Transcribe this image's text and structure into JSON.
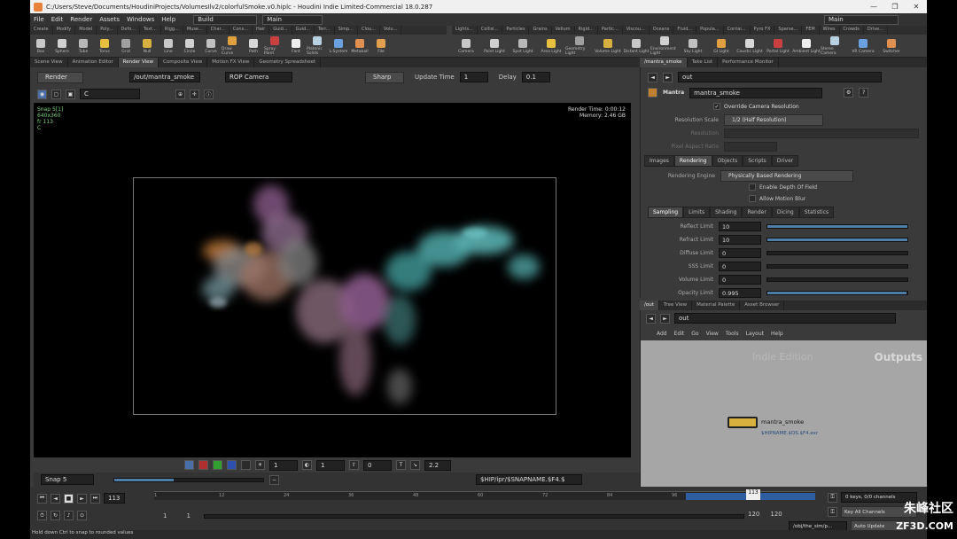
{
  "window": {
    "title": "C:/Users/Steve/Documents/HoudiniProjects/VolumesIlv2/colorfulSmoke.v0.hiplc - Houdini Indie Limited-Commercial 18.0.287",
    "minimize": "—",
    "maximize": "❐",
    "close": "✕"
  },
  "menubar": {
    "items": [
      "File",
      "Edit",
      "Render",
      "Assets",
      "Windows",
      "Help"
    ],
    "desktop": "Build",
    "scene": "Main",
    "right_scene": "Main"
  },
  "shelf": {
    "left_tabs": [
      "Create",
      "Modify",
      "Model",
      "Poly...",
      "Defo...",
      "Text...",
      "Rigg...",
      "Muse...",
      "Char...",
      "Cons...",
      "Hair",
      "Guid...",
      "Guid...",
      "Terr...",
      "Simp...",
      "Clou...",
      "Volu..."
    ],
    "left_tools": [
      "Box",
      "Sphere",
      "Tube",
      "Torus",
      "Grid",
      "Null",
      "Line",
      "Circle",
      "Curve",
      "Draw Curve",
      "Path",
      "Spray Paint",
      "Font",
      "Platonic Solids",
      "L-System",
      "Metaball",
      "File"
    ],
    "right_tabs": [
      "Lights...",
      "Collisi...",
      "Particles",
      "Grains",
      "Vellum",
      "Rigid...",
      "Partic...",
      "Viscou...",
      "Oceans",
      "Fluid...",
      "Popula...",
      "Contai...",
      "Pyro FX",
      "Sparse...",
      "FEM",
      "Wires",
      "Crowds",
      "Drive..."
    ],
    "right_tools": [
      "Camera",
      "Point Light",
      "Spot Light",
      "Area Light",
      "Geometry Light",
      "Volume Light",
      "Distant Light",
      "Environment Light",
      "Sky Light",
      "GI Light",
      "Caustic Light",
      "Portal Light",
      "Ambient Light",
      "Stereo Camera",
      "VR Camera",
      "Switcher"
    ]
  },
  "pane_tabs": {
    "left": [
      "Scene View",
      "Animation Editor",
      "Render View",
      "Composite View",
      "Motion FX View",
      "Geometry Spreadsheet"
    ],
    "params": [
      "/mantra_smoke",
      "Take List",
      "Performance Monitor"
    ],
    "network": [
      "/out",
      "Tree View",
      "Material Palette",
      "Asset Browser"
    ]
  },
  "render_toolbar": {
    "render_button": "Render",
    "rop_path": "/out/mantra_smoke",
    "camera": "ROP Camera",
    "sharp": "Sharp",
    "update_time_label": "Update Time",
    "update_time_value": "1",
    "delay_label": "Delay",
    "delay_value": "0.1",
    "channel": "C"
  },
  "viewport": {
    "snap_label": "Snap 5[1]",
    "resolution": "640x360",
    "frame_info": "fr 113",
    "channel_info": "C",
    "render_time": "Render Time: 0:00:12",
    "memory_label": "Memory:",
    "memory_value": "2.46 GB"
  },
  "viewport_bottom": {
    "field1": "1",
    "field2": "1",
    "field3": "0",
    "field4": "2.2"
  },
  "snap_bar": {
    "snap": "Snap 5",
    "path": "$HIP/ipr/$SNAPNAME.$F4.$"
  },
  "params": {
    "type": "Mantra",
    "node_name": "mantra_smoke",
    "override_camera": "Override Camera Resolution",
    "resolution_scale_label": "Resolution Scale",
    "resolution_scale_value": "1/2 (Half Resolution)",
    "resolution_label": "Resolution",
    "pixel_aspect_label": "Pixel Aspect Ratio",
    "tabs": [
      "Images",
      "Rendering",
      "Objects",
      "Scripts",
      "Driver"
    ],
    "rendering_engine_label": "Rendering Engine",
    "rendering_engine_value": "Physically Based Rendering",
    "depth_of_field": "Enable Depth Of Field",
    "motion_blur": "Allow Motion Blur",
    "sub_tabs": [
      "Sampling",
      "Limits",
      "Shading",
      "Render",
      "Dicing",
      "Statistics"
    ],
    "limits": [
      {
        "label": "Reflect Limit",
        "value": "10",
        "fraction": 1.0
      },
      {
        "label": "Refract Limit",
        "value": "10",
        "fraction": 1.0
      },
      {
        "label": "Diffuse Limit",
        "value": "0",
        "fraction": 0.0
      },
      {
        "label": "SSS Limit",
        "value": "0",
        "fraction": 0.0
      },
      {
        "label": "Volume Limit",
        "value": "0",
        "fraction": 0.0
      },
      {
        "label": "Opacity Limit",
        "value": "0.995",
        "fraction": 0.995
      }
    ]
  },
  "network": {
    "path": "out",
    "menu": [
      "Add",
      "Edit",
      "Go",
      "View",
      "Tools",
      "Layout",
      "Help"
    ],
    "watermark": "Indie Edition",
    "context": "Outputs",
    "node_name": "mantra_smoke",
    "node_output": "$HIPNAME.$OS.$F4.exr"
  },
  "timeline": {
    "current_frame": "113",
    "start": "1",
    "start2": "1",
    "end": "120",
    "end2": "120",
    "ticks": [
      "1",
      "12",
      "24",
      "36",
      "48",
      "60",
      "72",
      "84",
      "96",
      "108",
      "120"
    ],
    "keys_label": "0 keys, 0/0 channels",
    "key_all": "Key All Channels",
    "auto_update": "Auto Update",
    "obj_path": "/obj/the_sim/p..."
  },
  "status": {
    "message": "Hold down Ctrl to snap to rounded values"
  },
  "site_watermark": {
    "line1": "朱峰社区",
    "line2": "ZF3D.COM"
  }
}
